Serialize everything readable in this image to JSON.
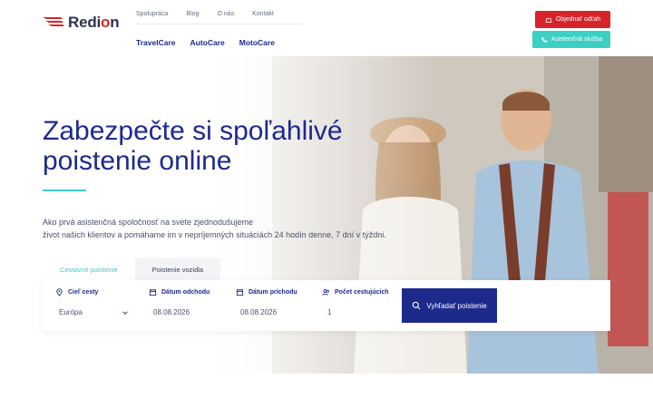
{
  "brand": {
    "logo_text_pre": "Redi",
    "logo_text_o": "o",
    "logo_text_post": "n",
    "primary": "#1d2a8c",
    "accent": "#3ccfc4",
    "red": "#d8232a"
  },
  "topnav": [
    "Spolupráca",
    "Blog",
    "O nás",
    "Kontakt"
  ],
  "mainnav": [
    "TravelCare",
    "AutoCare",
    "MotoCare"
  ],
  "actions": {
    "order_tow": "Objednať odťah",
    "assistance": "Asistenčná služba"
  },
  "hero": {
    "title_line1": "Zabezpečte si spoľahlivé",
    "title_line2": "poistenie online",
    "desc_line1": "Ako prvá asistenčná spoločnosť na svete zjednodušujeme",
    "desc_line2": "život našich klientov a pomáhame im v nepríjemných situáciách 24 hodín denne, 7 dní v týždni."
  },
  "search": {
    "tabs": [
      "Cestovné poistenie",
      "Poistenie vozidla"
    ],
    "active_tab": 0,
    "fields": {
      "destination_label": "Cieľ cesty",
      "destination_value": "Európa",
      "departure_label": "Dátum odchodu",
      "departure_value": "08.08.2026",
      "arrival_label": "Dátum príchodu",
      "arrival_value": "08.08.2026",
      "travelers_label": "Počet cestujúcich",
      "travelers_value": "1"
    },
    "button": "Vyhľadať poistenie"
  },
  "icons": [
    "car-icon",
    "phone-icon",
    "location-pin-icon",
    "calendar-icon",
    "users-icon",
    "search-icon",
    "chevron-down-icon"
  ]
}
